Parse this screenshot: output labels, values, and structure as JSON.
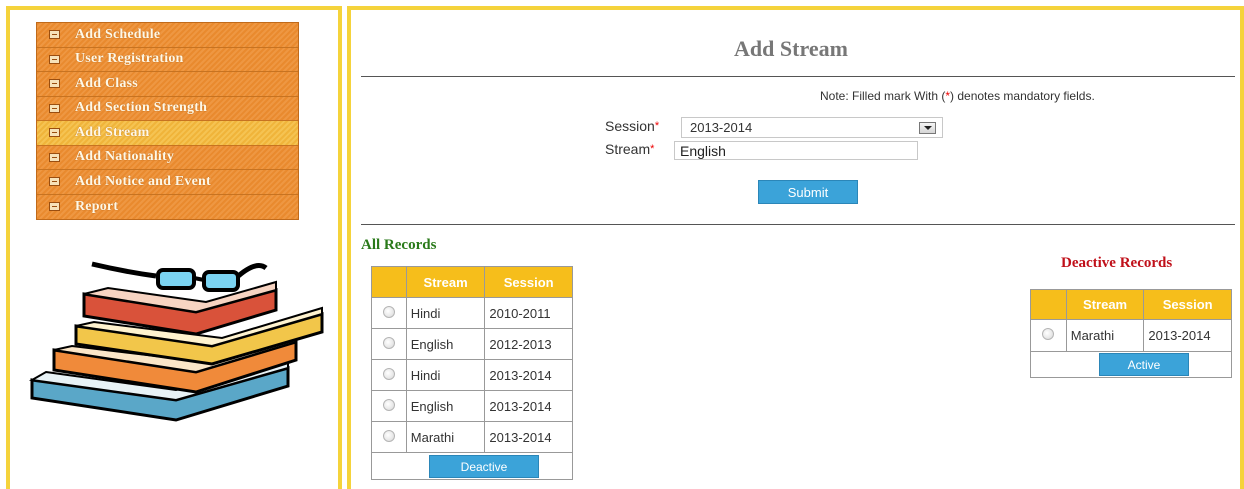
{
  "sidebar": {
    "items": [
      {
        "label": "Add Schedule"
      },
      {
        "label": "User Registration"
      },
      {
        "label": "Add Class"
      },
      {
        "label": "Add Section Strength"
      },
      {
        "label": "Add Stream",
        "active": true
      },
      {
        "label": "Add Nationality"
      },
      {
        "label": "Add Notice and Event"
      },
      {
        "label": "Report"
      }
    ]
  },
  "page": {
    "title": "Add Stream",
    "note_before": "Note: Filled mark With (",
    "note_star": "*",
    "note_after": ") denotes mandatory fields."
  },
  "form": {
    "session_label": "Session",
    "session_value": "2013-2014",
    "stream_label": "Stream",
    "stream_value": "English",
    "required_mark": "*",
    "submit_label": "Submit"
  },
  "all_records": {
    "title": "All Records",
    "headers": [
      "Stream",
      "Session"
    ],
    "rows": [
      {
        "stream": "Hindi",
        "session": "2010-2011"
      },
      {
        "stream": "English",
        "session": "2012-2013"
      },
      {
        "stream": "Hindi",
        "session": "2013-2014"
      },
      {
        "stream": "English",
        "session": "2013-2014"
      },
      {
        "stream": "Marathi",
        "session": "2013-2014"
      }
    ],
    "button_label": "Deactive"
  },
  "deactive_records": {
    "title": "Deactive Records",
    "headers": [
      "Stream",
      "Session"
    ],
    "rows": [
      {
        "stream": "Marathi",
        "session": "2013-2014"
      }
    ],
    "button_label": "Active"
  },
  "colors": {
    "frame": "#f5d33b",
    "menu": "#e98a2e",
    "menu_active": "#f0b43a",
    "all_records_title": "#2a7a1a",
    "deactive_title": "#c0101a",
    "table_header": "#f6be1b",
    "button": "#3ba3d9"
  }
}
